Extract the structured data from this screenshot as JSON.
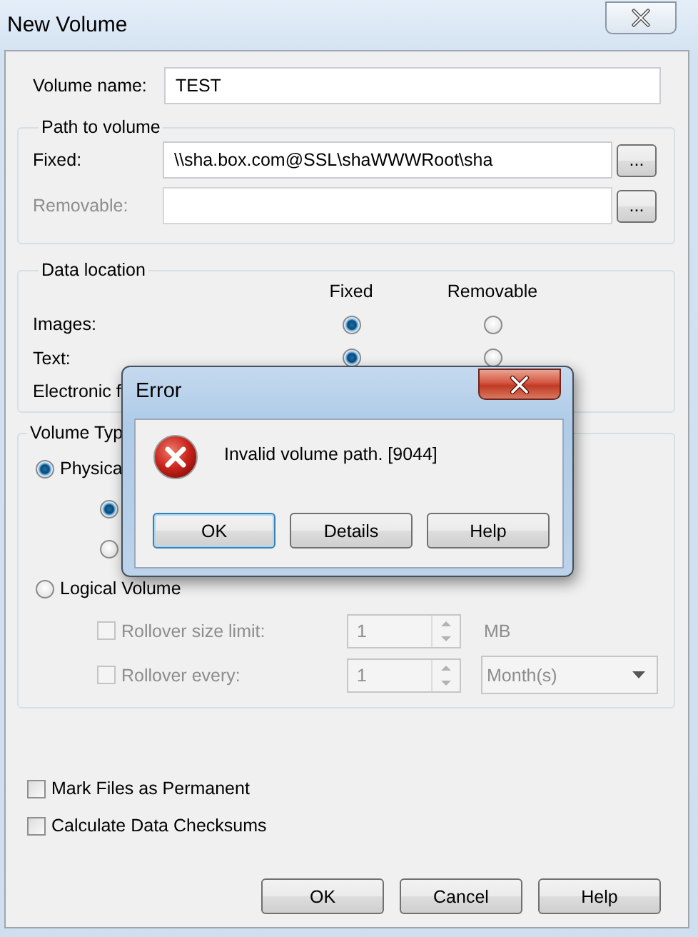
{
  "window": {
    "title": "New Volume"
  },
  "volume_name": {
    "label": "Volume name:",
    "value": "TEST"
  },
  "path_to_volume": {
    "title": "Path to volume",
    "rows": [
      {
        "label": "Fixed:",
        "value": "\\\\sha.box.com@SSL\\shaWWWRoot\\sha",
        "disabled": false,
        "browse": "..."
      },
      {
        "label": "Removable:",
        "disabled": true,
        "browse": "..."
      }
    ]
  },
  "data_location": {
    "title": "Data location",
    "columns": [
      "Fixed",
      "Removable"
    ],
    "rows": [
      {
        "label": "Images:",
        "choices": [
          {
            "selected": true
          },
          {
            "selected": false
          }
        ]
      },
      {
        "label": "Text:",
        "choices": [
          {
            "selected": true
          },
          {
            "selected": false
          }
        ]
      },
      {
        "label": "Electronic f",
        "choices": []
      }
    ]
  },
  "volume_type": {
    "title": "Volume Typ",
    "options": [
      {
        "label": "Physica",
        "selected": true,
        "children": [
          {
            "selected": true
          },
          {
            "selected": false
          }
        ]
      },
      {
        "label": "Logical Volume",
        "selected": false,
        "settings": [
          {
            "kind": "spin-unit",
            "label": "Rollover size limit:",
            "checked": false,
            "disabled": true,
            "value": "1",
            "unit": "MB"
          },
          {
            "kind": "spin-dropdown",
            "label": "Rollover every:",
            "checked": false,
            "disabled": true,
            "value": "1",
            "choice": "Month(s)"
          }
        ]
      }
    ]
  },
  "checkboxes": [
    {
      "label": "Mark Files as Permanent",
      "checked": false
    },
    {
      "label": "Calculate Data Checksums",
      "checked": false
    }
  ],
  "buttons": [
    {
      "label": "OK"
    },
    {
      "label": "Cancel"
    },
    {
      "label": "Help"
    }
  ],
  "error_dialog": {
    "title": "Error",
    "message": "Invalid volume path. [9044]",
    "buttons": [
      {
        "label": "OK",
        "focused": true
      },
      {
        "label": "Details",
        "focused": false
      },
      {
        "label": "Help",
        "focused": false
      }
    ]
  }
}
